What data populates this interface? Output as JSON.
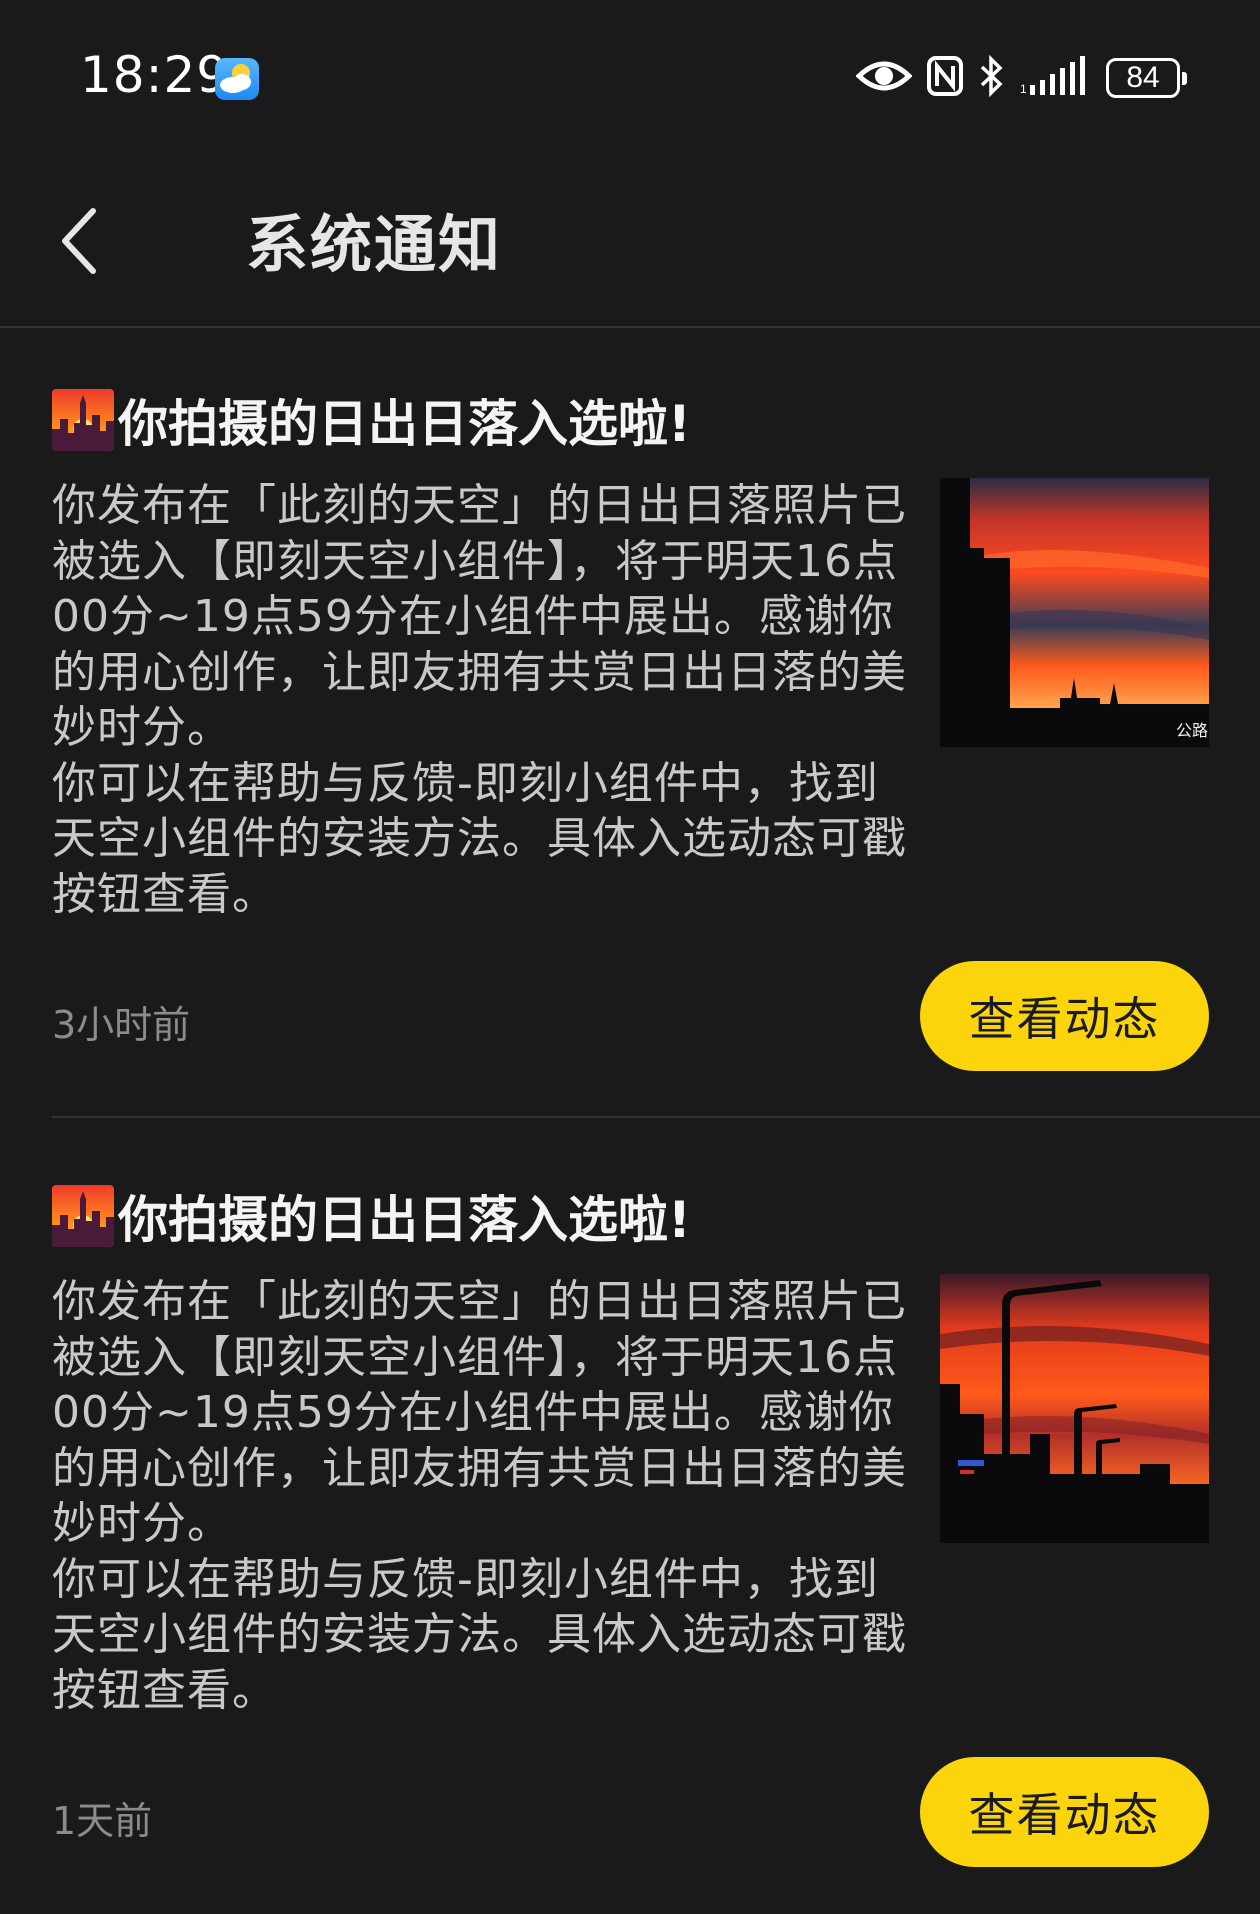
{
  "status_bar": {
    "time": "18:29",
    "battery": "84",
    "icons": [
      "weather-icon",
      "eye-icon",
      "nfc-icon",
      "bluetooth-icon",
      "signal-icon",
      "battery-icon"
    ]
  },
  "header": {
    "title": "系统通知",
    "back_icon": "chevron-left-icon"
  },
  "notifications": [
    {
      "emoji": "sunset-city-emoji",
      "title": "你拍摄的日出日落入选啦!",
      "body_paragraphs": [
        "你发布在「此刻的天空」的日出日落照片已被选入【即刻天空小组件】，将于明天16点00分~19点59分在小组件中展出。感谢你的用心创作，让即友拥有共赏日出日落的美妙时分。",
        "你可以在帮助与反馈-即刻小组件中，找到天空小组件的安装方法。具体入选动态可戳按钮查看。"
      ],
      "thumbnail_text": "公路",
      "time": "3小时前",
      "button": "查看动态"
    },
    {
      "emoji": "sunset-city-emoji",
      "title": "你拍摄的日出日落入选啦!",
      "body_paragraphs": [
        "你发布在「此刻的天空」的日出日落照片已被选入【即刻天空小组件】，将于明天16点00分~19点59分在小组件中展出。感谢你的用心创作，让即友拥有共赏日出日落的美妙时分。",
        "你可以在帮助与反馈-即刻小组件中，找到天空小组件的安装方法。具体入选动态可戳按钮查看。"
      ],
      "time": "1天前",
      "button": "查看动态"
    }
  ],
  "colors": {
    "background": "#1a1a1a",
    "accent_button": "#fbd40b",
    "divider": "#343434",
    "secondary_text": "#8c8c8c"
  }
}
